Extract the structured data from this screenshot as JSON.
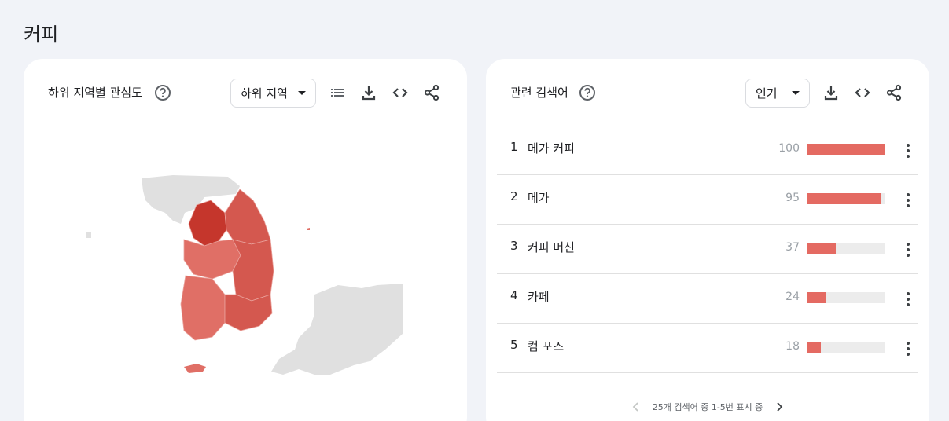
{
  "page": {
    "title": "커피"
  },
  "region_card": {
    "title": "하위 지역별 관심도",
    "select_value": "하위 지역",
    "icons": [
      "help-icon",
      "list-icon",
      "download-icon",
      "embed-icon",
      "share-icon"
    ]
  },
  "related_card": {
    "title": "관련 검색어",
    "select_value": "인기",
    "icons": [
      "help-icon",
      "download-icon",
      "embed-icon",
      "share-icon"
    ],
    "rows": [
      {
        "rank": "1",
        "term": "메가 커피",
        "value": "100",
        "level": 100
      },
      {
        "rank": "2",
        "term": "메가",
        "value": "95",
        "level": 95
      },
      {
        "rank": "3",
        "term": "커피 머신",
        "value": "37",
        "level": 37
      },
      {
        "rank": "4",
        "term": "카페",
        "value": "24",
        "level": 24
      },
      {
        "rank": "5",
        "term": "컴 포즈",
        "value": "18",
        "level": 18
      }
    ],
    "pager_text": "25개 검색어 중 1-5번 표시 중"
  },
  "colors": {
    "bar": "#e46a62",
    "bar_track": "#ececec",
    "map_land_other": "#e0e0e0",
    "map_region_high": "#c5362c",
    "map_region_mid": "#d4584f",
    "map_region_low": "#e06f66"
  }
}
